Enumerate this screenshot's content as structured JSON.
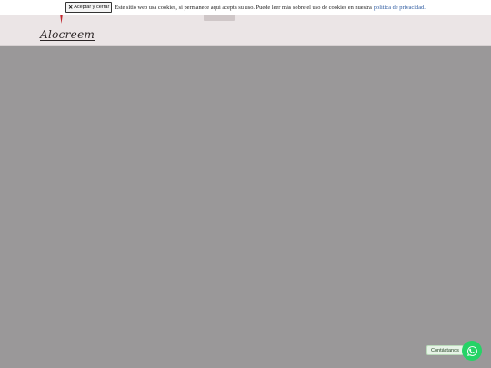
{
  "cookie_banner": {
    "accept_label": "Aceptar y cerrar",
    "message": "Este sitio web usa cookies, si permanece aquí acepta su uso. Puede leer más sobre el uso de cookies en nuestra",
    "privacy_link": "política de privacidad."
  },
  "header": {
    "logo_text": "Alocreem"
  },
  "contact": {
    "label": "Contáctanos"
  },
  "colors": {
    "overlay": "#9a9899",
    "whatsapp": "#25d366",
    "link": "#2c5aa0",
    "logo_accent": "#c0262d"
  },
  "icons": {
    "accept_close": "close-icon",
    "whatsapp": "whatsapp-icon",
    "logo_mark": "logo-mark-icon"
  }
}
